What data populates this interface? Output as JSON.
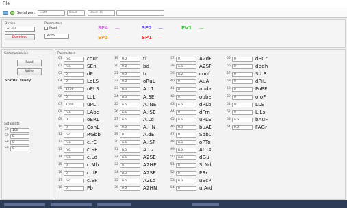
{
  "window": {
    "menu": "File"
  },
  "toolbar": {
    "port_label": "Serial port",
    "port_value": "COM",
    "baud_label": "Baud",
    "baud_value": "Baud (B)"
  },
  "top_panel": {
    "device_label": "Device",
    "device_value": "AT304",
    "parameters_label": "Parameters",
    "read_label": "Read",
    "write_label": "Write",
    "download_label": "Download",
    "status_items": [
      {
        "label": "SP4",
        "value": "—",
        "color": "#d36ee0"
      },
      {
        "label": "SP3",
        "value": "—",
        "color": "#f0a030"
      },
      {
        "label": "SP2",
        "value": "—",
        "color": "#6d55e6"
      },
      {
        "label": "SP1",
        "value": "—",
        "color": "#ef3b3b"
      },
      {
        "label": "PV1",
        "value": "—",
        "color": "#40d040"
      }
    ]
  },
  "sidebar": {
    "communication_label": "Communication",
    "read_button": "Read",
    "write_button": "Write",
    "status_text": "Status: ready",
    "set_points_label": "Set points",
    "set_points": [
      {
        "num": "SP",
        "value": "100"
      },
      {
        "num": "SP",
        "value": "0"
      },
      {
        "num": "SP",
        "value": "0"
      },
      {
        "num": "SP",
        "value": "0"
      }
    ]
  },
  "main": {
    "parameters_label": "Parameters",
    "columns": [
      {
        "rows": [
          {
            "num": "01",
            "value": "n.o.",
            "label": "cout"
          },
          {
            "num": "02",
            "value": "n.o.",
            "label": "SEn"
          },
          {
            "num": "03",
            "value": "0",
            "label": "dP"
          },
          {
            "num": "04",
            "value": "0",
            "label": "LoLS"
          },
          {
            "num": "05",
            "value": "1700",
            "label": "uPLS"
          },
          {
            "num": "06",
            "value": "0",
            "label": "LoL"
          },
          {
            "num": "07",
            "value": "1000",
            "label": "uPL"
          },
          {
            "num": "08",
            "value": "n.o.",
            "label": "LAbc"
          },
          {
            "num": "09",
            "value": "0",
            "label": "oERL"
          },
          {
            "num": "10",
            "value": "0",
            "label": "ConL"
          },
          {
            "num": "11",
            "value": "n.o.",
            "label": "RGbb"
          },
          {
            "num": "12",
            "value": "n.o.",
            "label": "c.rE"
          },
          {
            "num": "13",
            "value": "n.o.",
            "label": "c.SE"
          },
          {
            "num": "14",
            "value": "n.o.",
            "label": "c.Ld"
          },
          {
            "num": "15",
            "value": "0",
            "label": "c.Mb"
          },
          {
            "num": "16",
            "value": "0",
            "label": "c.dE"
          },
          {
            "num": "17",
            "value": "n.o.",
            "label": "c.SP"
          },
          {
            "num": "18",
            "value": "0",
            "label": "Pb"
          }
        ]
      },
      {
        "rows": [
          {
            "num": "19",
            "value": "0.0",
            "label": "ti"
          },
          {
            "num": "20",
            "value": "0.0",
            "label": "bd"
          },
          {
            "num": "21",
            "value": "0.0",
            "label": "tc"
          },
          {
            "num": "22",
            "value": "0.0",
            "label": "oRuL"
          },
          {
            "num": "23",
            "value": "n.o.",
            "label": "A.L1"
          },
          {
            "num": "24",
            "value": "n.o.",
            "label": "A.SE"
          },
          {
            "num": "25",
            "value": "n.o.",
            "label": "A.iNE"
          },
          {
            "num": "26",
            "value": "n.o.",
            "label": "A.iSE"
          },
          {
            "num": "27",
            "value": "n.o.",
            "label": "A.Ld"
          },
          {
            "num": "28",
            "value": "0.0",
            "label": "A.HN"
          },
          {
            "num": "29",
            "value": "0",
            "label": "A.dE"
          },
          {
            "num": "30",
            "value": "n.o.",
            "label": "A.iSP"
          },
          {
            "num": "31",
            "value": "n.o.",
            "label": "A.L2"
          },
          {
            "num": "32",
            "value": "n.o.",
            "label": "A2SE"
          },
          {
            "num": "33",
            "value": "0",
            "label": "A2HE"
          },
          {
            "num": "34",
            "value": "n.o.",
            "label": "A2SE"
          },
          {
            "num": "35",
            "value": "n.o.",
            "label": "A2Ld"
          },
          {
            "num": "36",
            "value": "0.0",
            "label": "A2HN"
          }
        ]
      },
      {
        "rows": [
          {
            "num": "37",
            "value": "0",
            "label": "A2dE"
          },
          {
            "num": "38",
            "value": "n.o.",
            "label": "A2SP"
          },
          {
            "num": "39",
            "value": "n.o.",
            "label": "coof"
          },
          {
            "num": "40",
            "value": "0",
            "label": "AuA"
          },
          {
            "num": "41",
            "value": "0",
            "label": "auda"
          },
          {
            "num": "42",
            "value": "0",
            "label": "oobe"
          },
          {
            "num": "43",
            "value": "n.o.",
            "label": "dPLb"
          },
          {
            "num": "44",
            "value": "0",
            "label": "dFrn"
          },
          {
            "num": "45",
            "value": "n.o.",
            "label": "uPLE"
          },
          {
            "num": "46",
            "value": "0.0",
            "label": "buAE"
          },
          {
            "num": "47",
            "value": "0",
            "label": "Sdbu"
          },
          {
            "num": "48",
            "value": "n.o.",
            "label": "oPTo"
          },
          {
            "num": "49",
            "value": "n.o.",
            "label": "AuTA"
          },
          {
            "num": "50",
            "value": "n.o.",
            "label": "dGu"
          },
          {
            "num": "51",
            "value": "0",
            "label": "SrNd"
          },
          {
            "num": "52",
            "value": "0",
            "label": "PRc"
          },
          {
            "num": "53",
            "value": "n.o.",
            "label": "uScP"
          },
          {
            "num": "54",
            "value": "0",
            "label": "u.Ard"
          }
        ]
      },
      {
        "rows": [
          {
            "num": "55",
            "value": "0",
            "label": "dECr"
          },
          {
            "num": "56",
            "value": "0",
            "label": "dbdh"
          },
          {
            "num": "57",
            "value": "0",
            "label": "Sd.R"
          },
          {
            "num": "58",
            "value": "0",
            "label": "dPiL"
          },
          {
            "num": "59",
            "value": "0",
            "label": "PoPE"
          },
          {
            "num": "60",
            "value": "0",
            "label": "o.oF"
          },
          {
            "num": "61",
            "value": "0",
            "label": "LLS"
          },
          {
            "num": "62",
            "value": "0",
            "label": "L.Ls"
          },
          {
            "num": "63",
            "value": "n.o.",
            "label": "bAuF"
          },
          {
            "num": "64",
            "value": "0.0",
            "label": "FAGr"
          }
        ]
      }
    ]
  },
  "colors": {
    "taskbar": "#2e3b57"
  }
}
